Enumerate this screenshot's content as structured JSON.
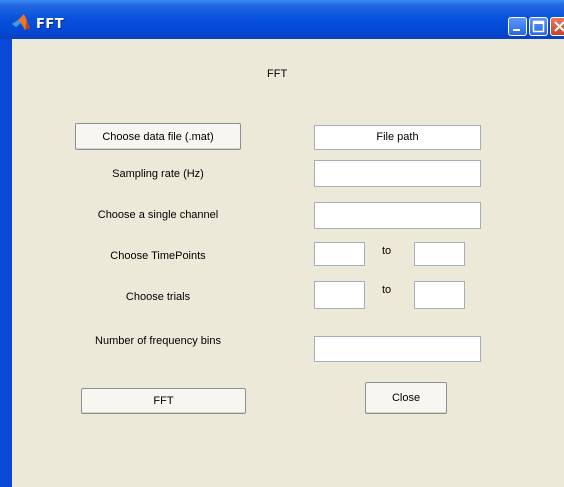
{
  "window": {
    "title": "FFT"
  },
  "heading": "FFT",
  "buttons": {
    "choose_file": "Choose data file (.mat)",
    "fft": "FFT",
    "close": "Close"
  },
  "labels": {
    "sampling_rate": "Sampling rate (Hz)",
    "single_channel": "Choose a single channel",
    "timepoints": "Choose TimePoints",
    "trials": "Choose trials",
    "freq_bins": "Number of frequency bins",
    "to_time": "to",
    "to_trials": "to"
  },
  "fields": {
    "file_path": "File path",
    "sampling_rate": "",
    "channel": "",
    "time_from": "",
    "time_to": "",
    "trial_from": "",
    "trial_to": "",
    "freq_bins": ""
  },
  "colors": {
    "titlebar": "#0a53dd",
    "background": "#ece9d8"
  },
  "icons": {
    "app": "matlab-logo-icon",
    "minimize": "minimize-icon",
    "maximize": "maximize-icon",
    "close": "close-icon"
  }
}
